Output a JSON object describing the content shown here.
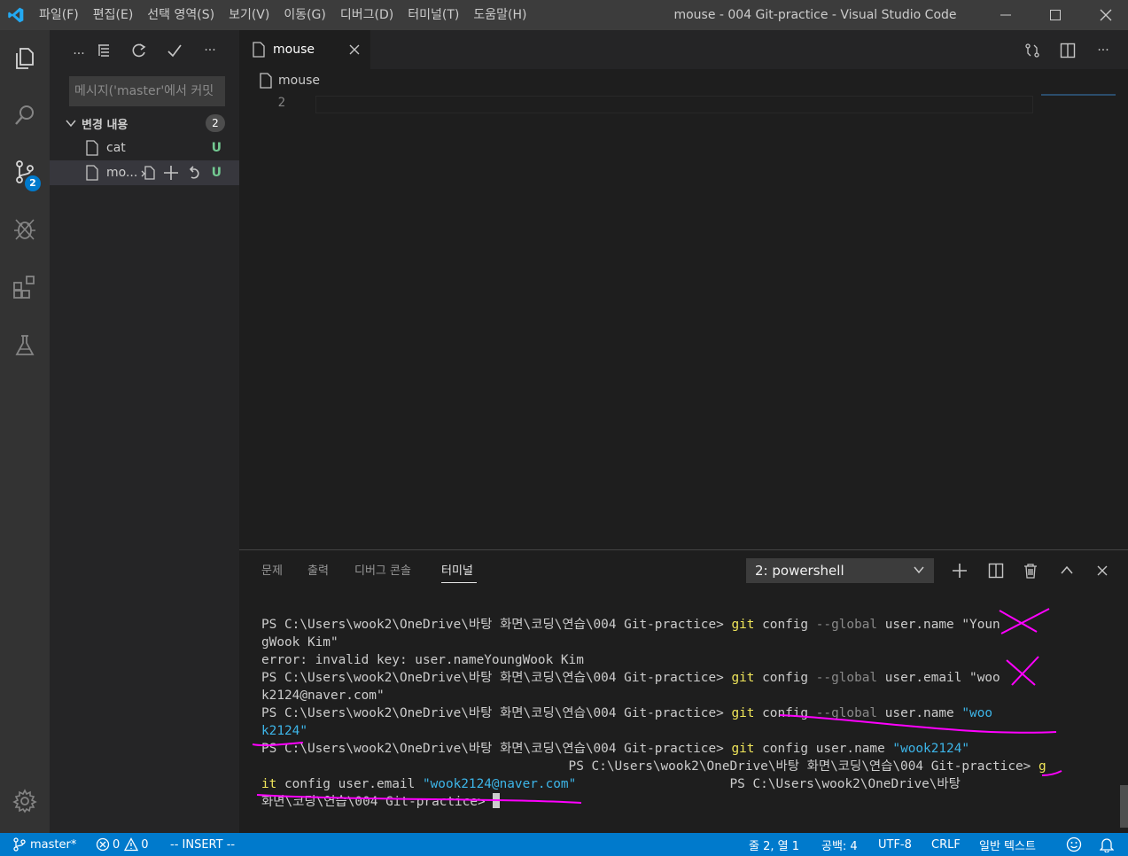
{
  "window": {
    "title": "mouse - 004 Git-practice - Visual Studio Code"
  },
  "menu": [
    "파일(F)",
    "편집(E)",
    "선택 영역(S)",
    "보기(V)",
    "이동(G)",
    "디버그(D)",
    "터미널(T)",
    "도움말(H)"
  ],
  "activity": {
    "scm_badge": "2"
  },
  "scm": {
    "toolbar_ellipsis": "...",
    "more_label": "···",
    "commit_placeholder": "메시지('master'에서 커밋",
    "changes_label": "변경 내용",
    "changes_count": "2",
    "files": [
      {
        "name": "cat",
        "status": "U"
      },
      {
        "name": "mo...",
        "status": "U"
      }
    ]
  },
  "editor": {
    "tab_label": "mouse",
    "breadcrumb": "mouse",
    "line_number": "2",
    "more_label": "···"
  },
  "panel": {
    "tabs": [
      "문제",
      "출력",
      "디버그 콘솔",
      "터미널"
    ],
    "active_tab": "터미널",
    "terminal_selector": "2: powershell"
  },
  "terminal": {
    "lines": [
      [
        {
          "t": "PS C:\\Users\\wook2\\OneDrive\\바탕 화면\\코딩\\연습\\004 Git-practice> ",
          "c": "t-arg"
        },
        {
          "t": "git",
          "c": "t-cmd"
        },
        {
          "t": " config ",
          "c": "t-arg"
        },
        {
          "t": "--global",
          "c": "t-flag"
        },
        {
          "t": " user.name \"Youn",
          "c": "t-arg"
        }
      ],
      [
        {
          "t": "gWook Kim\"",
          "c": "t-arg"
        }
      ],
      [
        {
          "t": "error: invalid key: user.nameYoungWook Kim",
          "c": "t-arg"
        }
      ],
      [
        {
          "t": "PS C:\\Users\\wook2\\OneDrive\\바탕 화면\\코딩\\연습\\004 Git-practice> ",
          "c": "t-arg"
        },
        {
          "t": "git",
          "c": "t-cmd"
        },
        {
          "t": " config ",
          "c": "t-arg"
        },
        {
          "t": "--global",
          "c": "t-flag"
        },
        {
          "t": " user.email \"woo",
          "c": "t-arg"
        }
      ],
      [
        {
          "t": "k2124@naver.com\"",
          "c": "t-arg"
        }
      ],
      [
        {
          "t": "PS C:\\Users\\wook2\\OneDrive\\바탕 화면\\코딩\\연습\\004 Git-practice> ",
          "c": "t-arg"
        },
        {
          "t": "git",
          "c": "t-cmd"
        },
        {
          "t": " config ",
          "c": "t-arg"
        },
        {
          "t": "--global",
          "c": "t-flag"
        },
        {
          "t": " user.name ",
          "c": "t-arg"
        },
        {
          "t": "\"woo",
          "c": "t-str"
        }
      ],
      [
        {
          "t": "k2124\"",
          "c": "t-str"
        }
      ],
      [
        {
          "t": "PS C:\\Users\\wook2\\OneDrive\\바탕 화면\\코딩\\연습\\004 Git-practice> ",
          "c": "t-arg"
        },
        {
          "t": "git",
          "c": "t-cmd"
        },
        {
          "t": " config user.name ",
          "c": "t-arg"
        },
        {
          "t": "\"wook2124\"",
          "c": "t-str"
        }
      ],
      [
        {
          "t": "                                        PS C:\\Users\\wook2\\OneDrive\\바탕 화면\\코딩\\연습\\004 Git-practice> ",
          "c": "t-arg"
        },
        {
          "t": "g",
          "c": "t-cmd"
        }
      ],
      [
        {
          "t": "it",
          "c": "t-cmd"
        },
        {
          "t": " config user.email ",
          "c": "t-arg"
        },
        {
          "t": "\"wook2124@naver.com\"",
          "c": "t-str"
        },
        {
          "t": "                    PS C:\\Users\\wook2\\OneDrive\\바탕",
          "c": "t-arg"
        }
      ],
      [
        {
          "t": "화면\\코딩\\연습\\004 Git-practice> ",
          "c": "t-arg"
        }
      ]
    ]
  },
  "status": {
    "branch": "master*",
    "errors": "0",
    "warnings": "0",
    "mode": "-- INSERT --",
    "position": "줄 2, 열 1",
    "indent": "공백: 4",
    "encoding": "UTF-8",
    "eol": "CRLF",
    "language": "일반 텍스트"
  },
  "colors": {
    "accent": "#007acc",
    "annotation": "#ff00ff",
    "untracked": "#73c991"
  }
}
